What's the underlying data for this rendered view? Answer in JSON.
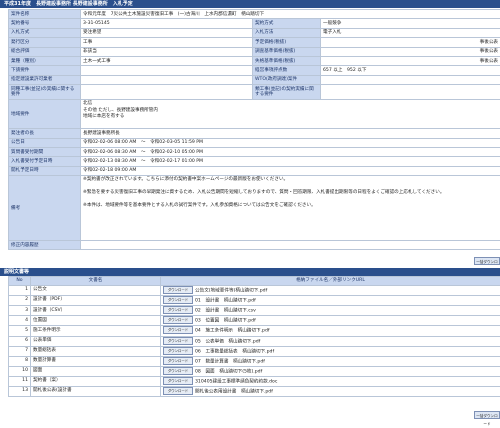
{
  "header": {
    "title": "平成31年度　長野建設事務所 長野建設事務所　入札予定"
  },
  "info": {
    "jigyo_label": "案件名称",
    "jigyo_value": "令和元年度　7災公共土木施設災害復旧工事　(一)古海川　上水内郡信濃町　柄山踏切下",
    "keiyaku_label": "契約番号",
    "keiyaku_value": "3-31-05145",
    "keiyakuhoushiki_label": "契約方式",
    "keiyakuhoushiki_value": "一般競争",
    "nyusatsu_label": "入札方式",
    "nyusatsu_value": "受注希望",
    "nyusatsuhoho_label": "入札方法",
    "nyusatsuhoho_value": "電子入札",
    "kubun_label": "発行区分",
    "kubun_value": "工事",
    "yotei_label": "予定価格(税抜)",
    "yotei_value": "事後公表",
    "sogo_label": "総合評価",
    "sogo_value": "非該当",
    "chosa_label": "調査基準価格(税抜)",
    "chosa_value": "事後公表",
    "gyoshu_label": "業種（種別）",
    "gyoshu_value": "土木一式工事",
    "shikkaku_label": "失格基準価格(税抜)",
    "shikkaku_value": "事後公表",
    "shitaukeyoken_label": "下請要件",
    "shitaukeyoken_value": "",
    "keishin_label": "経営事項評点数",
    "keishin_value": "657 以上　952 以下",
    "jisseki_label": "指定建設業許可業者",
    "jisseki_value": "",
    "wto_label": "WTO(政府調達)案件",
    "wto_value": "",
    "dokyu_label": "同種工事(並記)の実績に関する要件",
    "dokyu_value": "",
    "ruiji_label": "類工事(並記)の契約実績に関する要件",
    "ruiji_value": "",
    "chiiki_label": "地域要件",
    "chiiki_value": "北信\nその他 ただし、長野建設事務所管内\n地域に本店を有する",
    "hatchu_label": "発注者の長",
    "hatchu_value": "長野建設事務所長",
    "kokoku_label": "公告日",
    "kokoku_value": "令和02-02-06 08:00 AM　～　令和02-03-05 11:59 PM",
    "shitsumon_label": "質問書受付期間",
    "shitsumon_value": "令和02-02-06 08:30 AM　～　令和02-02-10 05:00 PM",
    "ukeharai_label": "入札書受付予定日時",
    "ukeharai_value": "令和02-02-13 08:30 AM　～　令和02-02-17 01:00 PM",
    "kaisatsu_label": "開札予定日時",
    "kaisatsu_value": "令和02-02-18 09:00 AM",
    "biko_label": "備考",
    "biko_value": "※契約書が改正されています。こちらに添付の契約書中案ホームページの最新版をお使いください。\n\n※緊急を要する災害復旧工事の早期発注に資するため、入札公告期間を短縮しておりますので、質問・回答期限、入札書提出期限等の日程をよくご確認の上応札してください。\n\n※本件は、地域要件等を基本要件とする入札の試行案件です。入札参加資格については公告文をご確認ください。",
    "shusei_label": "修正内容履歴",
    "shusei_value": ""
  },
  "download_all_label": "一括ダウンロード",
  "docs": {
    "section_title": "説明文書等",
    "col_no": "No",
    "col_name": "文書名",
    "col_file": "格納ファイル名／外部リンクURL",
    "button_label": "ダウンロード",
    "rows": [
      {
        "no": "1",
        "name": "公告文",
        "file": "公告文(地域要件等)柄山踏切下.pdf"
      },
      {
        "no": "2",
        "name": "設計書（PDF）",
        "file": "01　設計書　柄山踏切下.pdf"
      },
      {
        "no": "3",
        "name": "設計書（CSV）",
        "file": "02　設計書　柄山踏切下.csv"
      },
      {
        "no": "4",
        "name": "位置図",
        "file": "03　位置図　柄山踏切下.pdf"
      },
      {
        "no": "5",
        "name": "施工条件明示",
        "file": "04　施工条件明示　柄山踏切下.pdf"
      },
      {
        "no": "6",
        "name": "公表単価",
        "file": "05　公表単価　柄山踏切下.pdf"
      },
      {
        "no": "7",
        "name": "数量総括表",
        "file": "06　工事数量総括表　柄山踏切下.pdf"
      },
      {
        "no": "8",
        "name": "数量計算書",
        "file": "07　数量計算書　柄山踏切下.pdf"
      },
      {
        "no": "10",
        "name": "図面",
        "file": "08　図面　柄山踏切下(5枚).pdf"
      },
      {
        "no": "11",
        "name": "契約書（案）",
        "file": "310405建設工事標準請負契約約款.doc"
      },
      {
        "no": "13",
        "name": "開札後公表(設計書",
        "file": "開札後公表用設計書　柄山踏切下.pdf"
      }
    ]
  }
}
